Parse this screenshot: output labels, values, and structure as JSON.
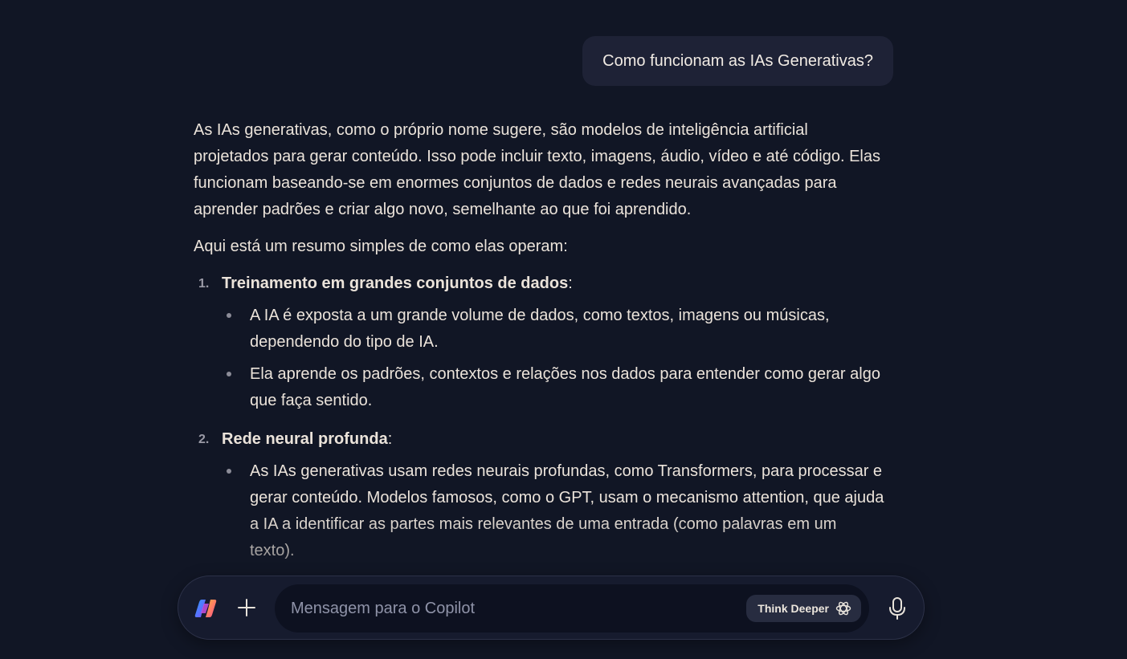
{
  "user_message": "Como funcionam as IAs Generativas?",
  "answer": {
    "intro": "As IAs generativas, como o próprio nome sugere, são modelos de inteligência artificial projetados para gerar conteúdo. Isso pode incluir texto, imagens, áudio, vídeo e até código. Elas funcionam baseando-se em enormes conjuntos de dados e redes neurais avançadas para aprender padrões e criar algo novo, semelhante ao que foi aprendido.",
    "summary_lead": "Aqui está um resumo simples de como elas operam:",
    "steps": [
      {
        "number": "1.",
        "title": "Treinamento em grandes conjuntos de dados",
        "suffix": ":",
        "bullets": [
          "A IA é exposta a um grande volume de dados, como textos, imagens ou músicas, dependendo do tipo de IA.",
          "Ela aprende os padrões, contextos e relações nos dados para entender como gerar algo que faça sentido."
        ]
      },
      {
        "number": "2.",
        "title": "Rede neural profunda",
        "suffix": ":",
        "bullets": [
          "As IAs generativas usam redes neurais profundas, como Transformers, para processar e gerar conteúdo. Modelos famosos, como o GPT, usam o mecanismo attention, que ajuda a IA a identificar as partes mais relevantes de uma entrada (como palavras em um texto)."
        ]
      }
    ]
  },
  "composer": {
    "logo_icon": "copilot-logo-icon",
    "add_icon": "plus-icon",
    "placeholder": "Mensagem para o Copilot",
    "think_deeper_label": "Think Deeper",
    "think_icon": "think-deeper-icon",
    "mic_icon": "microphone-icon"
  },
  "colors": {
    "background": "#111625",
    "user_bubble": "#1e2236",
    "composer": "#161b2e",
    "input": "#0d1120",
    "text": "#ebe3da"
  }
}
